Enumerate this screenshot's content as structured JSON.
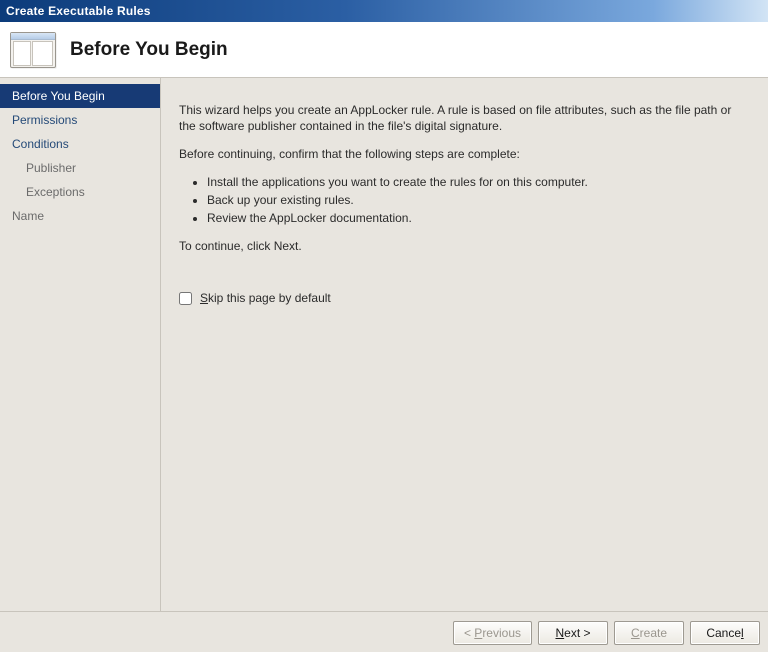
{
  "window": {
    "title": "Create Executable Rules"
  },
  "header": {
    "page_title": "Before You Begin"
  },
  "sidebar": {
    "items": [
      {
        "label": "Before You Begin",
        "active": true,
        "indent": false
      },
      {
        "label": "Permissions",
        "active": false,
        "indent": false
      },
      {
        "label": "Conditions",
        "active": false,
        "indent": false
      },
      {
        "label": "Publisher",
        "active": false,
        "indent": true
      },
      {
        "label": "Exceptions",
        "active": false,
        "indent": true
      },
      {
        "label": "Name",
        "active": false,
        "indent": false
      }
    ]
  },
  "main": {
    "intro": "This wizard helps you create an AppLocker rule. A rule is based on file attributes, such as the file path or the software publisher contained in the file's digital signature.",
    "confirm_text": "Before continuing, confirm that the following steps are complete:",
    "bullets": [
      "Install the applications you want to create the rules for on this computer.",
      "Back up your existing rules.",
      "Review the AppLocker documentation."
    ],
    "continue_text": "To continue, click Next.",
    "skip_checkbox": {
      "checked": false,
      "prefix": "S",
      "rest": "kip this page by default"
    }
  },
  "footer": {
    "previous": {
      "prefix": "< ",
      "ul": "P",
      "rest": "revious",
      "enabled": false
    },
    "next": {
      "ul": "N",
      "rest": "ext >",
      "enabled": true
    },
    "create": {
      "ul": "C",
      "rest": "reate",
      "enabled": false
    },
    "cancel": {
      "prefix": "Cance",
      "ul": "l",
      "enabled": true
    }
  }
}
